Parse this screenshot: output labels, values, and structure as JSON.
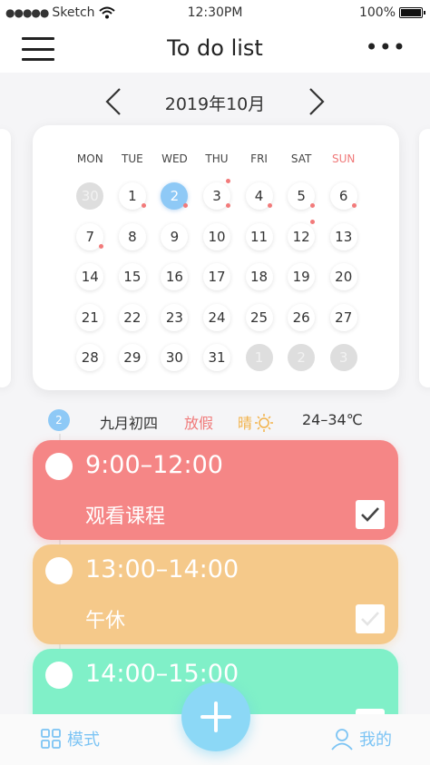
{
  "status_bar": {
    "carrier": "Sketch",
    "time": "12:30PM",
    "battery": "100%"
  },
  "header": {
    "title": "To do list"
  },
  "calendar": {
    "month": "2019年10月",
    "weekdays": [
      "MON",
      "TUE",
      "WED",
      "THU",
      "FRI",
      "SAT",
      "SUN"
    ],
    "days": [
      {
        "label": "30",
        "state": "other"
      },
      {
        "label": "1",
        "dot": "br"
      },
      {
        "label": "2",
        "state": "selected",
        "dot": "br"
      },
      {
        "label": "3",
        "dot": "both"
      },
      {
        "label": "4",
        "dot": "br"
      },
      {
        "label": "5",
        "dot": "br"
      },
      {
        "label": "6",
        "dot": "br"
      },
      {
        "label": "7",
        "dot": "br"
      },
      {
        "label": "8"
      },
      {
        "label": "9"
      },
      {
        "label": "10"
      },
      {
        "label": "11"
      },
      {
        "label": "12",
        "dot": "tr"
      },
      {
        "label": "13"
      },
      {
        "label": "14"
      },
      {
        "label": "15"
      },
      {
        "label": "16"
      },
      {
        "label": "17"
      },
      {
        "label": "18"
      },
      {
        "label": "19"
      },
      {
        "label": "20"
      },
      {
        "label": "21"
      },
      {
        "label": "22"
      },
      {
        "label": "23"
      },
      {
        "label": "24"
      },
      {
        "label": "25"
      },
      {
        "label": "26"
      },
      {
        "label": "27"
      },
      {
        "label": "28"
      },
      {
        "label": "29"
      },
      {
        "label": "30"
      },
      {
        "label": "31"
      },
      {
        "label": "1",
        "state": "other"
      },
      {
        "label": "2",
        "state": "other"
      },
      {
        "label": "3",
        "state": "other"
      }
    ]
  },
  "day_info": {
    "date_badge": "2",
    "lunar": "九月初四",
    "holiday": "放假",
    "weather": "晴",
    "temperature": "24–34℃"
  },
  "tasks": [
    {
      "time": "9:00–12:00",
      "title": "观看课程",
      "color": "#f58686",
      "checked": true
    },
    {
      "time": "13:00–14:00",
      "title": "午休",
      "color": "#f5c98a",
      "checked": false
    },
    {
      "time": "14:00–15:00",
      "title": "",
      "color": "#80f0c8",
      "checked": false
    }
  ],
  "tabbar": {
    "mode_label": "模式",
    "mine_label": "我的"
  },
  "colors": {
    "accent": "#8ec9f6",
    "holiday": "#f07a7a",
    "sunny": "#f2b24a"
  }
}
